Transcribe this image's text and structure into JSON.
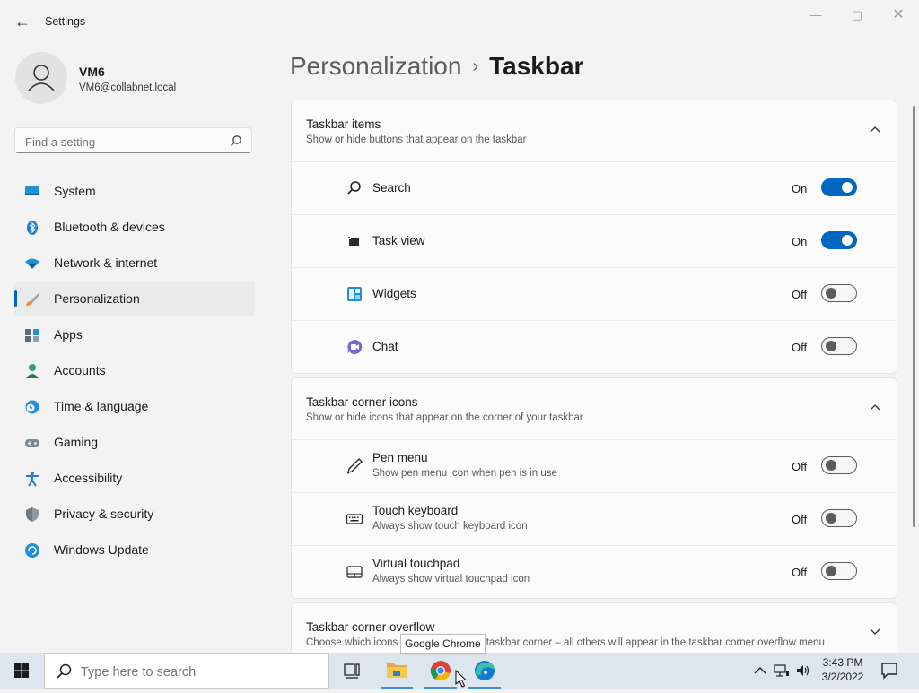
{
  "window": {
    "title": "Settings",
    "back_glyph": "←",
    "minimize_glyph": "—",
    "maximize_glyph": "▢",
    "close_glyph": "✕"
  },
  "profile": {
    "name": "VM6",
    "email": "VM6@collabnet.local"
  },
  "search": {
    "placeholder": "Find a setting"
  },
  "nav": [
    {
      "label": "System",
      "icon": "monitor-icon"
    },
    {
      "label": "Bluetooth & devices",
      "icon": "bluetooth-icon"
    },
    {
      "label": "Network & internet",
      "icon": "wifi-icon"
    },
    {
      "label": "Personalization",
      "icon": "brush-icon",
      "active": true
    },
    {
      "label": "Apps",
      "icon": "apps-icon"
    },
    {
      "label": "Accounts",
      "icon": "person-icon"
    },
    {
      "label": "Time & language",
      "icon": "globe-clock-icon"
    },
    {
      "label": "Gaming",
      "icon": "gamepad-icon"
    },
    {
      "label": "Accessibility",
      "icon": "accessibility-icon"
    },
    {
      "label": "Privacy & security",
      "icon": "shield-icon"
    },
    {
      "label": "Windows Update",
      "icon": "update-icon"
    }
  ],
  "breadcrumb": {
    "parent": "Personalization",
    "separator": "›",
    "current": "Taskbar"
  },
  "sections": {
    "items": {
      "title": "Taskbar items",
      "subtitle": "Show or hide buttons that appear on the taskbar",
      "rows": [
        {
          "label": "Search",
          "state": "On"
        },
        {
          "label": "Task view",
          "state": "On"
        },
        {
          "label": "Widgets",
          "state": "Off"
        },
        {
          "label": "Chat",
          "state": "Off"
        }
      ]
    },
    "corner": {
      "title": "Taskbar corner icons",
      "subtitle": "Show or hide icons that appear on the corner of your taskbar",
      "rows": [
        {
          "label": "Pen menu",
          "desc": "Show pen menu icon when pen is in use",
          "state": "Off"
        },
        {
          "label": "Touch keyboard",
          "desc": "Always show touch keyboard icon",
          "state": "Off"
        },
        {
          "label": "Virtual touchpad",
          "desc": "Always show virtual touchpad icon",
          "state": "Off"
        }
      ]
    },
    "overflow": {
      "title": "Taskbar corner overflow",
      "subtitle": "Choose which icons may appear in the taskbar corner – all others will appear in the taskbar corner overflow menu"
    }
  },
  "tooltip": "Google Chrome",
  "taskbar": {
    "search_placeholder": "Type here to search",
    "time": "3:43 PM",
    "date": "3/2/2022"
  },
  "colors": {
    "accent": "#0067c0",
    "taskbar": "#dde6ef"
  }
}
